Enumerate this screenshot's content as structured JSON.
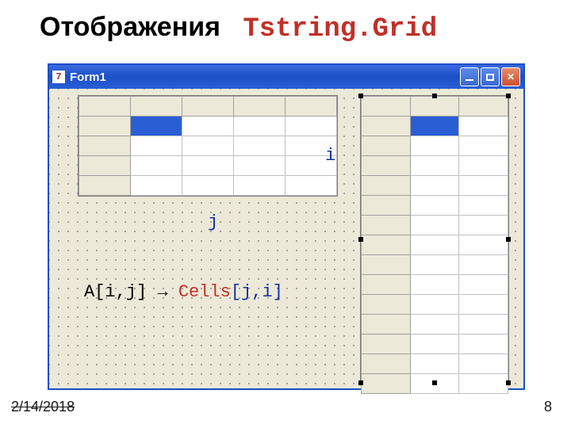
{
  "title_black": "Отображения",
  "title_red": "Tstring.Grid",
  "window": {
    "caption": "Form1",
    "app_icon_text": "7"
  },
  "labels": {
    "i": "i",
    "j": "j"
  },
  "formula": {
    "lhs": "A[i,j]",
    "arrow": " → ",
    "rhs_name": "Cells",
    "rhs_args": "[j,i]"
  },
  "footer": {
    "date": "2/14/2018",
    "page": "8"
  }
}
